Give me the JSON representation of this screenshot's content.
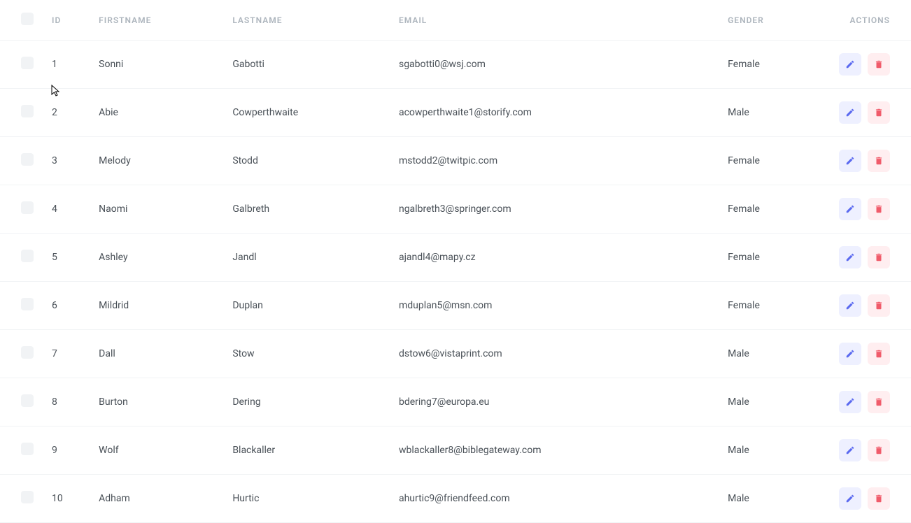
{
  "table": {
    "headers": {
      "id": "ID",
      "firstname": "FIRSTNAME",
      "lastname": "LASTNAME",
      "email": "EMAIL",
      "gender": "GENDER",
      "actions": "ACTIONS"
    },
    "rows": [
      {
        "id": "1",
        "firstname": "Sonni",
        "lastname": "Gabotti",
        "email": "sgabotti0@wsj.com",
        "gender": "Female"
      },
      {
        "id": "2",
        "firstname": "Abie",
        "lastname": "Cowperthwaite",
        "email": "acowperthwaite1@storify.com",
        "gender": "Male"
      },
      {
        "id": "3",
        "firstname": "Melody",
        "lastname": "Stodd",
        "email": "mstodd2@twitpic.com",
        "gender": "Female"
      },
      {
        "id": "4",
        "firstname": "Naomi",
        "lastname": "Galbreth",
        "email": "ngalbreth3@springer.com",
        "gender": "Female"
      },
      {
        "id": "5",
        "firstname": "Ashley",
        "lastname": "Jandl",
        "email": "ajandl4@mapy.cz",
        "gender": "Female"
      },
      {
        "id": "6",
        "firstname": "Mildrid",
        "lastname": "Duplan",
        "email": "mduplan5@msn.com",
        "gender": "Female"
      },
      {
        "id": "7",
        "firstname": "Dall",
        "lastname": "Stow",
        "email": "dstow6@vistaprint.com",
        "gender": "Male"
      },
      {
        "id": "8",
        "firstname": "Burton",
        "lastname": "Dering",
        "email": "bdering7@europa.eu",
        "gender": "Male"
      },
      {
        "id": "9",
        "firstname": "Wolf",
        "lastname": "Blackaller",
        "email": "wblackaller8@biblegateway.com",
        "gender": "Male"
      },
      {
        "id": "10",
        "firstname": "Adham",
        "lastname": "Hurtic",
        "email": "ahurtic9@friendfeed.com",
        "gender": "Male"
      }
    ]
  },
  "colors": {
    "editIcon": "#5b6af0",
    "deleteIcon": "#f05b6a"
  }
}
